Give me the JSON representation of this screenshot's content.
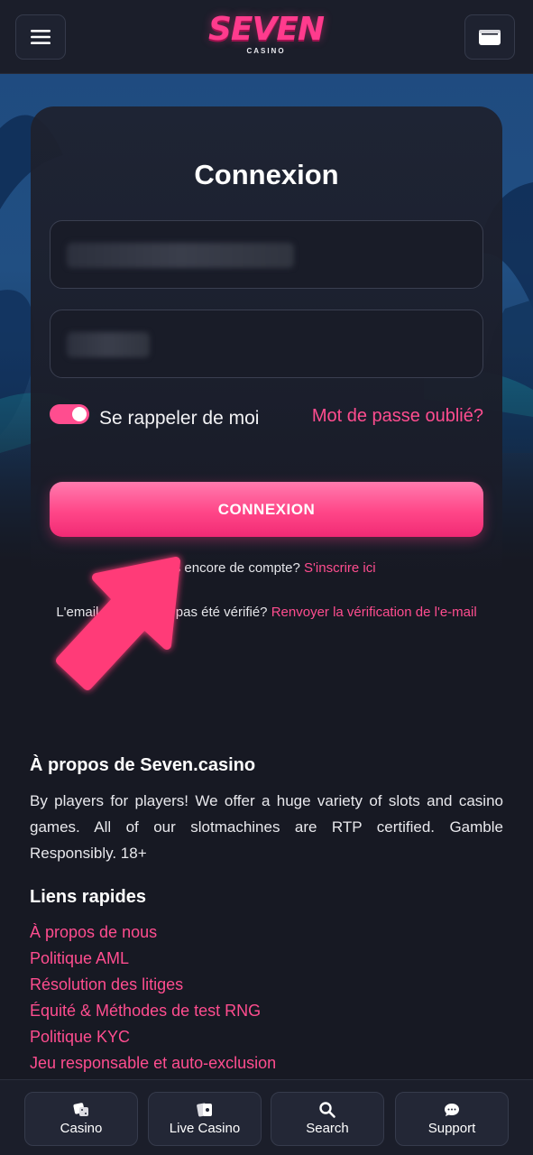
{
  "header": {
    "logo_text": "SEVEN",
    "logo_sub": "CASINO",
    "menu_icon": "hamburger-menu-icon",
    "wallet_icon": "wallet-icon"
  },
  "login": {
    "title": "Connexion",
    "remember_label": "Se rappeler de moi",
    "remember_checked": true,
    "forgot_link": "Mot de passe oublié?",
    "submit_label": "CONNEXION",
    "no_account_text": "Pas encore de compte?",
    "signup_link": "S'inscrire ici",
    "unverified_text": "L'email n'a toujours pas été vérifié?",
    "resend_link": "Renvoyer la vérification de l'e-mail"
  },
  "about": {
    "title": "À propos de Seven.casino",
    "text": "By players for players! We offer a huge variety of slots and casino games. All of our slotmachines are RTP certified. Gamble Responsibly. 18+"
  },
  "quick_links": {
    "title": "Liens rapides",
    "items": [
      "À propos de nous",
      "Politique AML",
      "Résolution des litiges",
      "Équité & Méthodes de test RNG",
      "Politique KYC",
      "Jeu responsable et auto-exclusion"
    ]
  },
  "bottom_nav": [
    {
      "label": "Casino",
      "icon": "dice-icon"
    },
    {
      "label": "Live Casino",
      "icon": "cards-icon"
    },
    {
      "label": "Search",
      "icon": "search-icon"
    },
    {
      "label": "Support",
      "icon": "chat-icon"
    }
  ],
  "colors": {
    "accent": "#ff4d8f",
    "background": "#171923",
    "panel": "#1e212e"
  }
}
